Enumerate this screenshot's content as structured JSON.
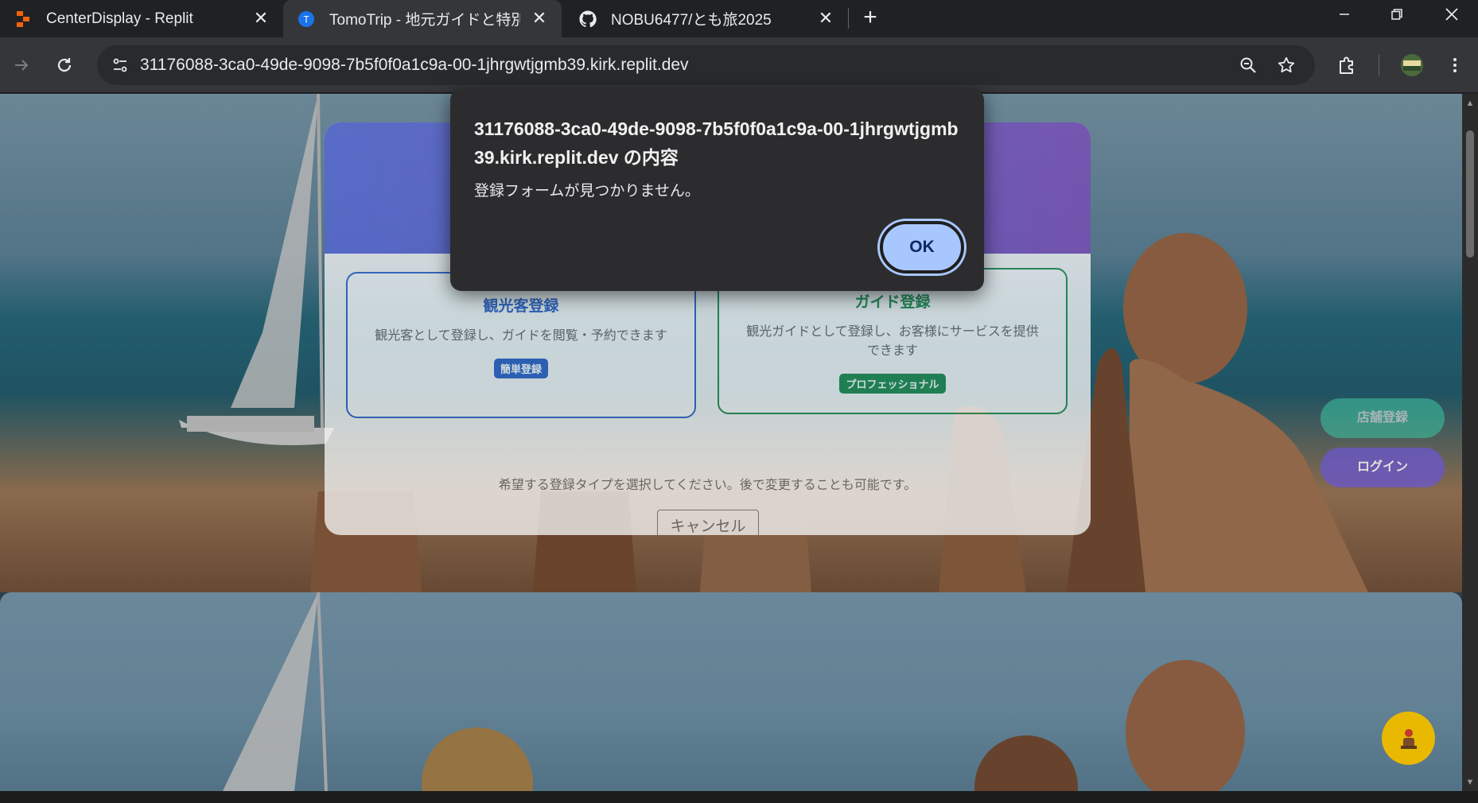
{
  "browser": {
    "tabs": [
      {
        "title": "CenterDisplay - Replit",
        "favicon": "replit-icon"
      },
      {
        "title": "TomoTrip - 地元ガイドと特別な旅",
        "favicon": "tomotrip-icon",
        "favicon_letter": "T"
      },
      {
        "title": "NOBU6477/とも旅2025",
        "favicon": "github-icon"
      }
    ],
    "new_tab_label": "+",
    "url": "31176088-3ca0-49de-9098-7b5f0f0a1c9a-00-1jhrgwtjgmb39.kirk.replit.dev"
  },
  "page": {
    "tourist_option": {
      "title": "観光客登録",
      "description": "観光客として登録し、ガイドを閲覧・予約できます",
      "badge": "簡単登録"
    },
    "guide_option": {
      "title": "ガイド登録",
      "description": "観光ガイドとして登録し、お客様にサービスを提供できます",
      "badge": "プロフェッショナル"
    },
    "hint": "希望する登録タイプを選択してください。後で変更することも可能です。",
    "cancel_label": "キャンセル",
    "store_register_label": "店舗登録",
    "login_label": "ログイン"
  },
  "alert": {
    "origin_title": "31176088-3ca0-49de-9098-7b5f0f0a1c9a-00-1jhrgwtjgmb39.kirk.replit.dev の内容",
    "message": "登録フォームが見つかりません。",
    "ok_label": "OK"
  },
  "colors": {
    "accent": "#a9c7ff",
    "tourist": "#2f62c8",
    "guide": "#1f8c4e",
    "header_gradient_start": "#5566d6",
    "header_gradient_end": "#7a4ab8"
  }
}
